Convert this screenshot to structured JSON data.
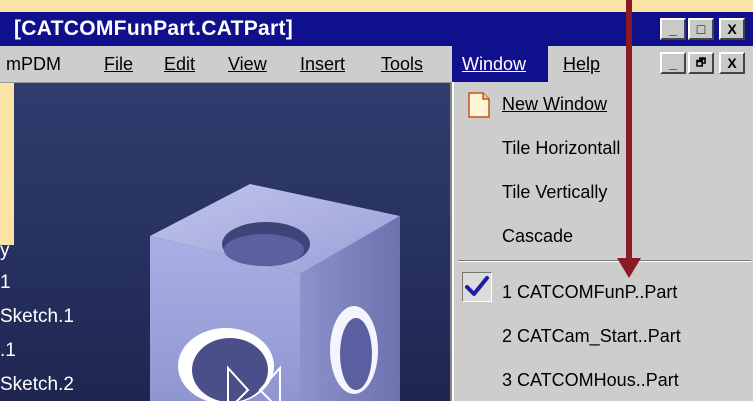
{
  "window": {
    "title": "[CATCOMFunPart.CATPart]",
    "title_buttons": [
      "_",
      "□",
      "X"
    ],
    "mdi_buttons": [
      "_",
      "🗗",
      "X"
    ]
  },
  "menubar": {
    "items": [
      {
        "label": "mPDM",
        "name": "menu-mpdm"
      },
      {
        "label": "File",
        "name": "menu-file"
      },
      {
        "label": "Edit",
        "name": "menu-edit"
      },
      {
        "label": "View",
        "name": "menu-view"
      },
      {
        "label": "Insert",
        "name": "menu-insert"
      },
      {
        "label": "Tools",
        "name": "menu-tools"
      },
      {
        "label": "Window",
        "name": "menu-window"
      },
      {
        "label": "Help",
        "name": "menu-help"
      }
    ],
    "active": "Window"
  },
  "tree": {
    "items": [
      "y",
      "1",
      "Sketch.1",
      ".1",
      "Sketch.2"
    ]
  },
  "window_menu": {
    "items": [
      "New Window",
      "Tile Horizontall",
      "Tile Vertically",
      "Cascade"
    ],
    "documents": [
      "1 CATCOMFunP..Part",
      "2 CATCam_Start..Part",
      "3 CATCOMHous..Part"
    ],
    "checked_index": 0
  },
  "colors": {
    "titlebar": "#11108c",
    "menubar": "#cdcdcd",
    "viewport": "#2b3565",
    "arrow": "#8b1a24",
    "background": "#fbe3a6",
    "cube": "#a8aee0"
  },
  "icons": [
    "new-window-icon",
    "checkmark-icon",
    "minimize-icon",
    "maximize-icon",
    "restore-icon",
    "close-icon"
  ]
}
